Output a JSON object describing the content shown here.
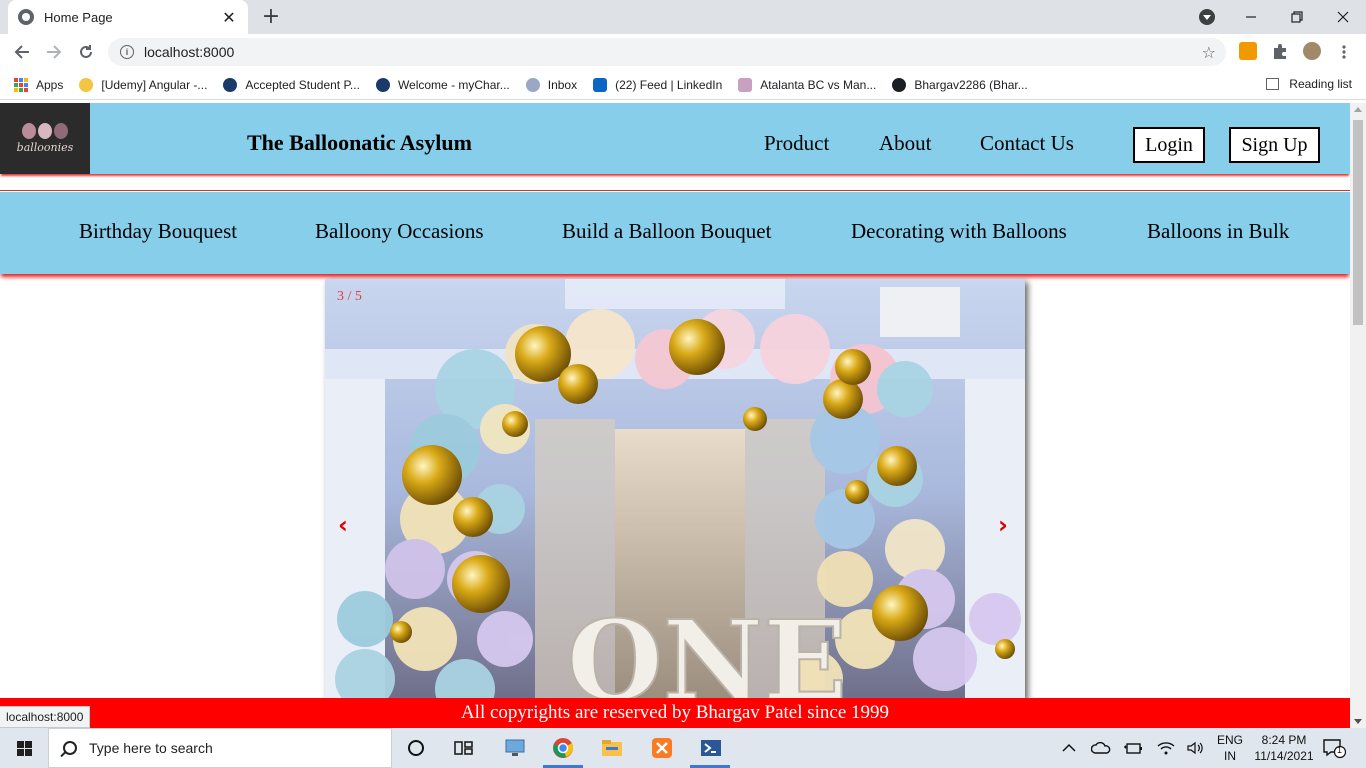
{
  "browser": {
    "tab_title": "Home Page",
    "url": "localhost:8000",
    "bookmarks": [
      {
        "label": "Apps"
      },
      {
        "label": "[Udemy] Angular -..."
      },
      {
        "label": "Accepted Student P..."
      },
      {
        "label": "Welcome - myChar..."
      },
      {
        "label": "Inbox"
      },
      {
        "label": "(22) Feed | LinkedIn"
      },
      {
        "label": "Atalanta BC vs Man..."
      },
      {
        "label": "Bhargav2286 (Bhar..."
      }
    ],
    "reading_list": "Reading list",
    "status_url": "localhost:8000"
  },
  "site": {
    "brand": "The Balloonatic Asylum",
    "logo_text": "balloonies",
    "nav": {
      "product": "Product",
      "about": "About",
      "contact": "Contact Us",
      "login": "Login",
      "signup": "Sign Up"
    },
    "categories": [
      "Birthday Bouquest",
      "Balloony Occasions",
      "Build a Balloon Bouquet",
      "Decorating with Balloons",
      "Balloons in Bulk"
    ],
    "carousel": {
      "counter": "3 / 5",
      "prev": "‹",
      "next": "›",
      "image_text": "ONE"
    },
    "footer": "All copyrights are reserved by Bhargav Patel since 1999"
  },
  "taskbar": {
    "search_placeholder": "Type here to search",
    "lang_top": "ENG",
    "lang_bottom": "IN",
    "time": "8:24 PM",
    "date": "11/14/2021",
    "notifications": "1"
  },
  "colors": {
    "header_bg": "#87ceeb",
    "accent_red": "#ff0000"
  }
}
